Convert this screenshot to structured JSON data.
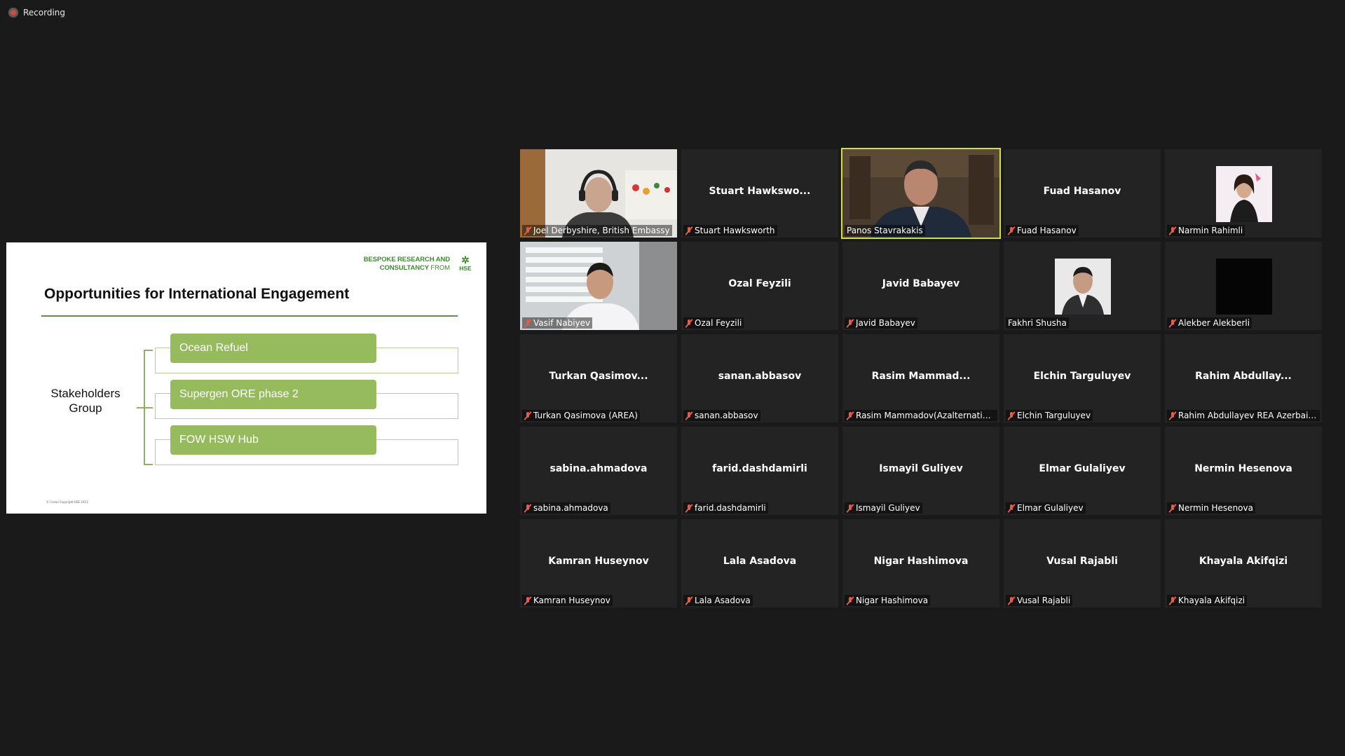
{
  "recording": {
    "label": "Recording"
  },
  "slide": {
    "logo_line1": "BESPOKE RESEARCH AND",
    "logo_line2": "CONSULTANCY",
    "logo_from": "FROM",
    "logo_mark": "HSE",
    "title": "Opportunities for International Engagement",
    "group_label": "Stakeholders Group",
    "items": [
      "Ocean Refuel",
      "Supergen ORE phase 2",
      "FOW HSW Hub"
    ],
    "copyright": "© Crown Copyright HSE 2021"
  },
  "participants": [
    {
      "tile": "",
      "caption": "Joel Derbyshire, British Embassy",
      "muted": true,
      "video": "joel",
      "active": false
    },
    {
      "tile": "Stuart  Hawkswo...",
      "caption": "Stuart Hawksworth",
      "muted": true,
      "video": "",
      "active": false
    },
    {
      "tile": "",
      "caption": "Panos Stavrakakis",
      "muted": false,
      "video": "panos",
      "active": true
    },
    {
      "tile": "Fuad Hasanov",
      "caption": "Fuad Hasanov",
      "muted": true,
      "video": "",
      "active": false
    },
    {
      "tile": "",
      "caption": "Narmin Rahimli",
      "muted": true,
      "video": "narmin",
      "active": false
    },
    {
      "tile": "",
      "caption": "Vasif Nabiyev",
      "muted": true,
      "video": "vasif",
      "active": false
    },
    {
      "tile": "Ozal Feyzili",
      "caption": "Ozal Feyzili",
      "muted": true,
      "video": "",
      "active": false
    },
    {
      "tile": "Javid Babayev",
      "caption": "Javid Babayev",
      "muted": true,
      "video": "",
      "active": false
    },
    {
      "tile": "",
      "caption": "Fakhri Shusha",
      "muted": false,
      "video": "fakhri",
      "active": false
    },
    {
      "tile": "",
      "caption": "Alekber Alekberli",
      "muted": true,
      "video": "black",
      "active": false
    },
    {
      "tile": "Turkan  Qasimov...",
      "caption": "Turkan Qasimova (AREA)",
      "muted": true,
      "video": "",
      "active": false
    },
    {
      "tile": "sanan.abbasov",
      "caption": "sanan.abbasov",
      "muted": true,
      "video": "",
      "active": false
    },
    {
      "tile": "Rasim  Mammad...",
      "caption": "Rasim Mammadov(Azalternative...",
      "muted": true,
      "video": "",
      "active": false
    },
    {
      "tile": "Elchin Targuluyev",
      "caption": "Elchin Targuluyev",
      "muted": true,
      "video": "",
      "active": false
    },
    {
      "tile": "Rahim  Abdullay...",
      "caption": "Rahim Abdullayev   REA Azerbaij...",
      "muted": true,
      "video": "",
      "active": false
    },
    {
      "tile": "sabina.ahmadova",
      "caption": "sabina.ahmadova",
      "muted": true,
      "video": "",
      "active": false
    },
    {
      "tile": "farid.dashdamirli",
      "caption": "farid.dashdamirli",
      "muted": true,
      "video": "",
      "active": false
    },
    {
      "tile": "Ismayil Guliyev",
      "caption": "Ismayil Guliyev",
      "muted": true,
      "video": "",
      "active": false
    },
    {
      "tile": "Elmar Gulaliyev",
      "caption": "Elmar Gulaliyev",
      "muted": true,
      "video": "",
      "active": false
    },
    {
      "tile": "Nermin Hesenova",
      "caption": "Nermin Hesenova",
      "muted": true,
      "video": "",
      "active": false
    },
    {
      "tile": "Kamran Huseynov",
      "caption": "Kamran Huseynov",
      "muted": true,
      "video": "",
      "active": false
    },
    {
      "tile": "Lala Asadova",
      "caption": "Lala Asadova",
      "muted": true,
      "video": "",
      "active": false
    },
    {
      "tile": "Nigar Hashimova",
      "caption": "Nigar Hashimova",
      "muted": true,
      "video": "",
      "active": false
    },
    {
      "tile": "Vusal Rajabli",
      "caption": "Vusal Rajabli",
      "muted": true,
      "video": "",
      "active": false
    },
    {
      "tile": "Khayala Akifqizi",
      "caption": "Khayala Akifqizi",
      "muted": true,
      "video": "",
      "active": false
    }
  ],
  "colors": {
    "background": "#1a1a1a",
    "tile": "#232323",
    "active_speaker": "#cfe13a",
    "muted_mic": "#e65a4a",
    "slide_green": "#95bb5c"
  }
}
